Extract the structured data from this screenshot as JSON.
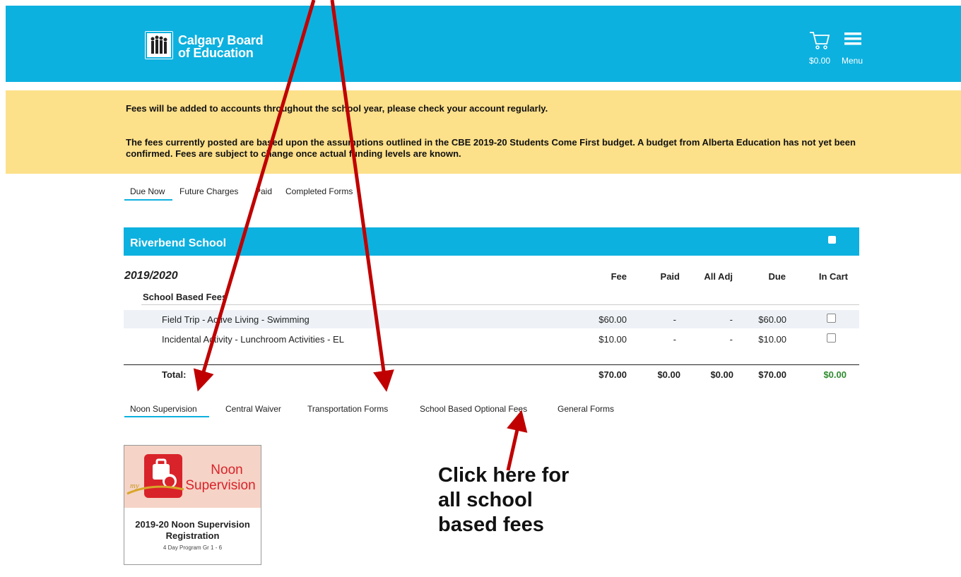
{
  "header": {
    "brand_line1": "Calgary Board",
    "brand_line2": "of Education",
    "cart_amount": "$0.00",
    "menu_label": "Menu",
    "bg_color": "#0db1df"
  },
  "notice": {
    "line1": "Fees will be added to accounts throughout the school year, please check your account regularly.",
    "line2": "The fees currently posted are based upon the assumptions outlined in the CBE 2019-20 Students Come First budget. A budget from Alberta Education has not yet been confirmed. Fees are subject to change once actual funding levels are known.",
    "bg_color": "#fde08a"
  },
  "tabs": [
    {
      "label": "Due Now",
      "active": true
    },
    {
      "label": "Future Charges",
      "active": false
    },
    {
      "label": "Paid",
      "active": false
    },
    {
      "label": "Completed Forms",
      "active": false
    }
  ],
  "school": {
    "name": "Riverbend School",
    "year": "2019/2020",
    "columns": {
      "fee": "Fee",
      "paid": "Paid",
      "adj": "All Adj",
      "due": "Due",
      "cart": "In Cart"
    },
    "section": "School Based Fees",
    "rows": [
      {
        "name": "Field Trip - Active Living - Swimming",
        "fee": "$60.00",
        "paid": "-",
        "adj": "-",
        "due": "$60.00"
      },
      {
        "name": "Incidental Activity - Lunchroom Activities - EL",
        "fee": "$10.00",
        "paid": "-",
        "adj": "-",
        "due": "$10.00"
      }
    ],
    "total": {
      "label": "Total:",
      "fee": "$70.00",
      "paid": "$0.00",
      "adj": "$0.00",
      "due": "$70.00",
      "cart": "$0.00"
    }
  },
  "form_tabs": [
    {
      "label": "Noon Supervision",
      "active": true
    },
    {
      "label": "Central Waiver",
      "active": false
    },
    {
      "label": "Transportation Forms",
      "active": false
    },
    {
      "label": "School Based Optional Fees",
      "active": false
    },
    {
      "label": "General Forms",
      "active": false
    }
  ],
  "card": {
    "banner_word1": "Noon",
    "banner_word2": "Supervision",
    "banner_my": "my",
    "title": "2019-20 Noon Supervision Registration",
    "subtitle": "4 Day Program Gr 1 - 6"
  },
  "callout": {
    "text": "Click here for all school based fees",
    "arrow_color": "#c00000"
  }
}
